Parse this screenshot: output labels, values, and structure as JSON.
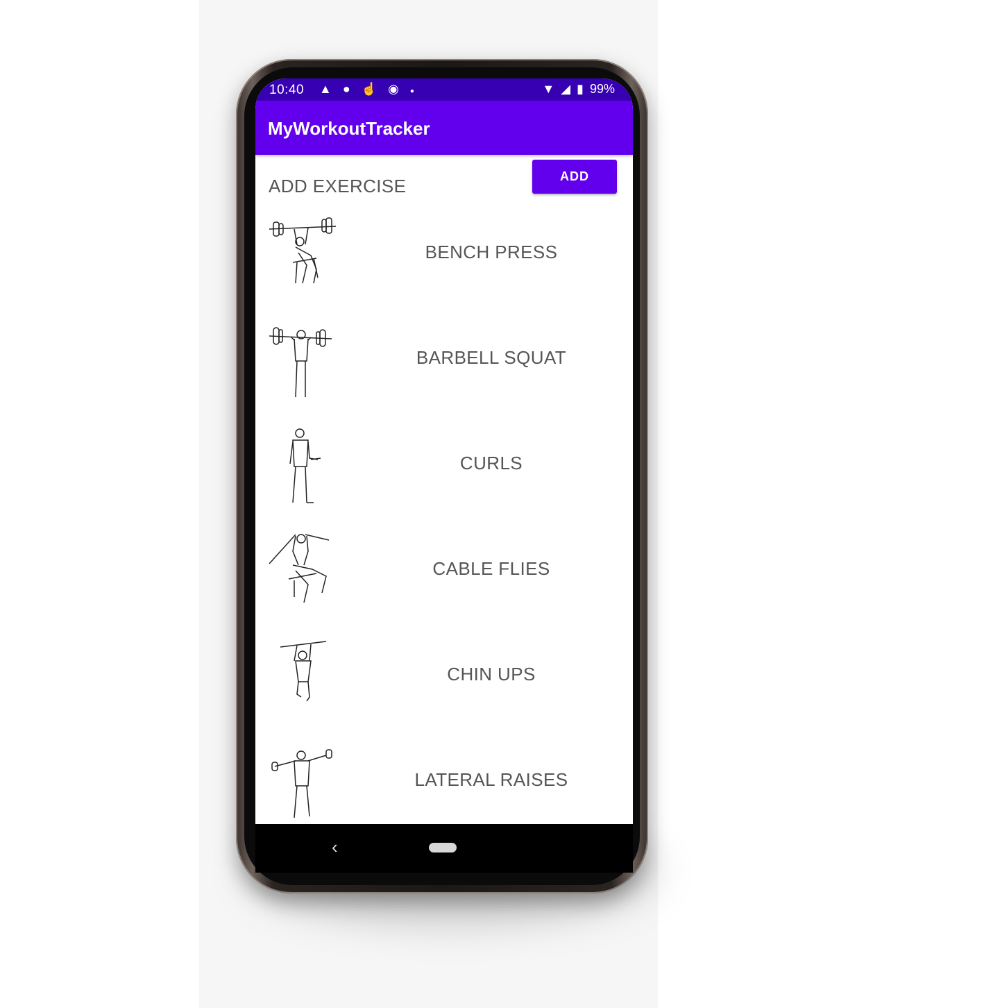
{
  "status_bar": {
    "time": "10:40",
    "notification_icons": [
      "snapchat-icon",
      "p-icon",
      "hand-icon",
      "app-icon",
      "dot-icon"
    ],
    "battery": "99%"
  },
  "app_bar": {
    "title": "MyWorkoutTracker"
  },
  "add_section": {
    "label": "ADD EXERCISE",
    "button_label": "ADD"
  },
  "exercises": [
    {
      "name": "BENCH PRESS",
      "icon": "bench-press-figure-icon"
    },
    {
      "name": "BARBELL SQUAT",
      "icon": "barbell-squat-figure-icon"
    },
    {
      "name": "CURLS",
      "icon": "curls-figure-icon"
    },
    {
      "name": "CABLE FLIES",
      "icon": "cable-flies-figure-icon"
    },
    {
      "name": "CHIN UPS",
      "icon": "chin-ups-figure-icon"
    },
    {
      "name": "LATERAL RAISES",
      "icon": "lateral-raises-figure-icon"
    }
  ],
  "colors": {
    "primary": "#6200ee",
    "primary_dark": "#3700b3",
    "text": "#555555"
  }
}
